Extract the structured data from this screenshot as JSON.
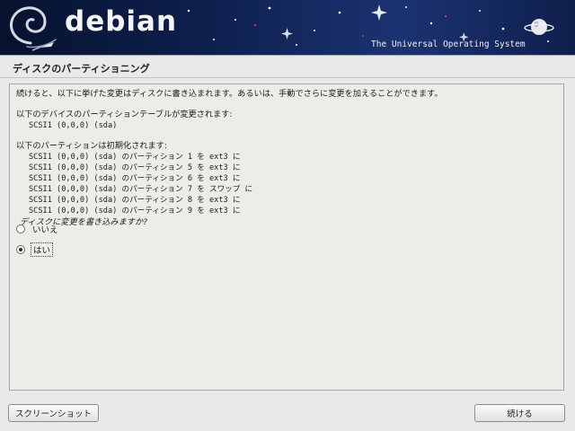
{
  "banner": {
    "logo_text": "debian",
    "tagline": "The Universal Operating System"
  },
  "page": {
    "title": "ディスクのパーティショニング"
  },
  "content": {
    "intro": "続けると、以下に挙げた変更はディスクに書き込まれます。あるいは、手動でさらに変更を加えることができます。",
    "table_heading": "以下のデバイスのパーティションテーブルが変更されます:",
    "table_devices": [
      "SCSI1 (0,0,0) (sda)"
    ],
    "format_heading": "以下のパーティションは初期化されます:",
    "format_items": [
      "SCSI1 (0,0,0) (sda) のパーティション 1 を ext3 に",
      "SCSI1 (0,0,0) (sda) のパーティション 5 を ext3 に",
      "SCSI1 (0,0,0) (sda) のパーティション 6 を ext3 に",
      "SCSI1 (0,0,0) (sda) のパーティション 7 を スワップ に",
      "SCSI1 (0,0,0) (sda) のパーティション 8 を ext3 に",
      "SCSI1 (0,0,0) (sda) のパーティション 9 を ext3 に"
    ],
    "question": "ディスクに変更を書き込みますか?"
  },
  "options": [
    {
      "label": "いいえ",
      "checked": false
    },
    {
      "label": "はい",
      "checked": true
    }
  ],
  "buttons": {
    "screenshot": "スクリーンショット",
    "continue": "続ける"
  }
}
